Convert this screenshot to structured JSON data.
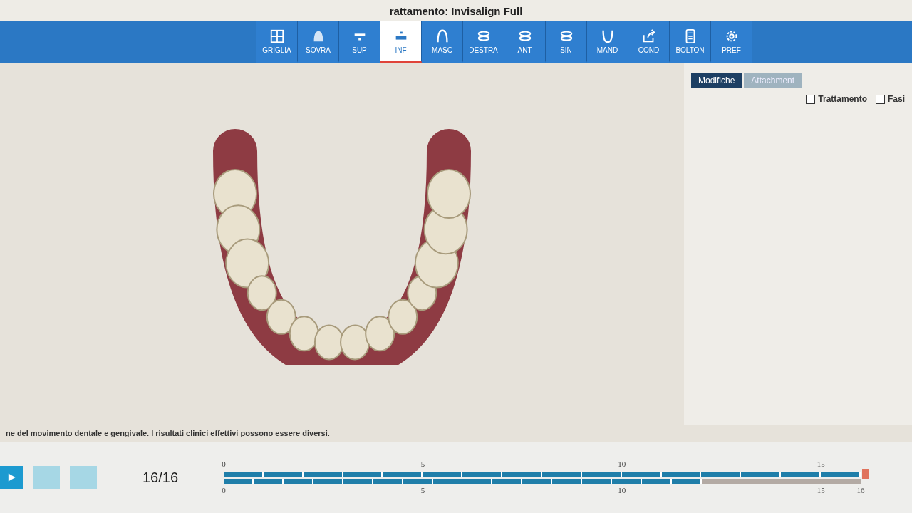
{
  "title": "rattamento: Invisalign Full",
  "toolbar": [
    {
      "label": "GRIGLIA",
      "kind": "grid",
      "selected": false
    },
    {
      "label": "SOVRA",
      "kind": "overlay",
      "selected": false
    },
    {
      "label": "SUP",
      "kind": "upper",
      "selected": false
    },
    {
      "label": "INF",
      "kind": "lower",
      "selected": true
    },
    {
      "label": "MASC",
      "kind": "arch",
      "selected": false
    },
    {
      "label": "DESTRA",
      "kind": "side",
      "selected": false
    },
    {
      "label": "ANT",
      "kind": "front",
      "selected": false
    },
    {
      "label": "SIN",
      "kind": "side",
      "selected": false
    },
    {
      "label": "MAND",
      "kind": "mand",
      "selected": false
    },
    {
      "label": "COND",
      "kind": "share",
      "selected": false
    },
    {
      "label": "BOLTON",
      "kind": "calc",
      "selected": false
    },
    {
      "label": "PREF",
      "kind": "gear",
      "selected": false
    }
  ],
  "panel": {
    "tabs": [
      {
        "label": "Modifiche",
        "selected": true
      },
      {
        "label": "Attachment",
        "selected": false
      }
    ],
    "checks": [
      {
        "label": "Trattamento",
        "checked": false
      },
      {
        "label": "Fasi",
        "checked": false
      }
    ]
  },
  "disclaimer": "ne del movimento dentale e gengivale. I risultati clinici effettivi possono essere diversi.",
  "player": {
    "stage": "16/16"
  },
  "timeline": {
    "top_ticks": [
      "0",
      "5",
      "10",
      "15"
    ],
    "bottom_ticks": [
      "0",
      "5",
      "10",
      "15",
      "16"
    ],
    "upper_bar": {
      "level": 1
    },
    "lower_bar": {
      "level": 0.75
    }
  }
}
